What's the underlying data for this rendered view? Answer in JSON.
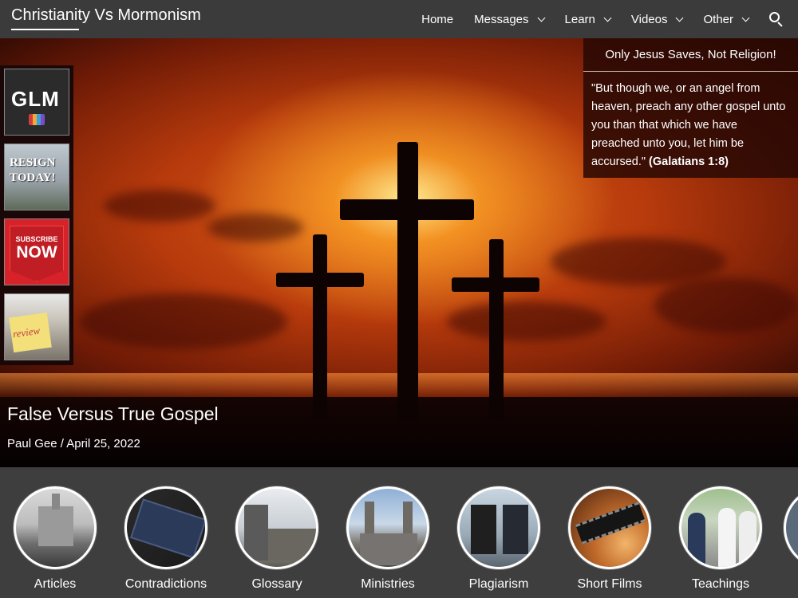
{
  "header": {
    "site_title": "Christianity Vs Mormonism",
    "nav": [
      {
        "label": "Home",
        "has_dropdown": false
      },
      {
        "label": "Messages",
        "has_dropdown": true
      },
      {
        "label": "Learn",
        "has_dropdown": true
      },
      {
        "label": "Videos",
        "has_dropdown": true
      },
      {
        "label": "Other",
        "has_dropdown": true
      }
    ],
    "search_icon": "search-icon"
  },
  "sidebar": {
    "thumbs": [
      {
        "name": "glm",
        "text": "GLM"
      },
      {
        "name": "resign-today",
        "text": "RESIGN TODAY!"
      },
      {
        "name": "subscribe-now",
        "small": "SUBSCRIBE",
        "big": "NOW"
      },
      {
        "name": "review",
        "text": "review"
      }
    ]
  },
  "quote_box": {
    "heading": "Only Jesus Saves, Not Religion!",
    "quote": "\"But though we, or an angel from heaven, preach any other gospel unto you than that which we have preached unto you, let him be accursed.\"",
    "reference": "(Galatians 1:8)"
  },
  "post": {
    "title": "False Versus True Gospel",
    "meta": "Paul Gee / April 25, 2022"
  },
  "categories": [
    {
      "label": "Articles"
    },
    {
      "label": "Contradictions"
    },
    {
      "label": "Glossary"
    },
    {
      "label": "Ministries"
    },
    {
      "label": "Plagiarism"
    },
    {
      "label": "Short Films"
    },
    {
      "label": "Teachings"
    }
  ],
  "colors": {
    "header_bg": "#3b3b3b",
    "strip_bg": "#3e3e3e",
    "sky_orange": "#e2651a",
    "sky_dark": "#3a0d04"
  }
}
